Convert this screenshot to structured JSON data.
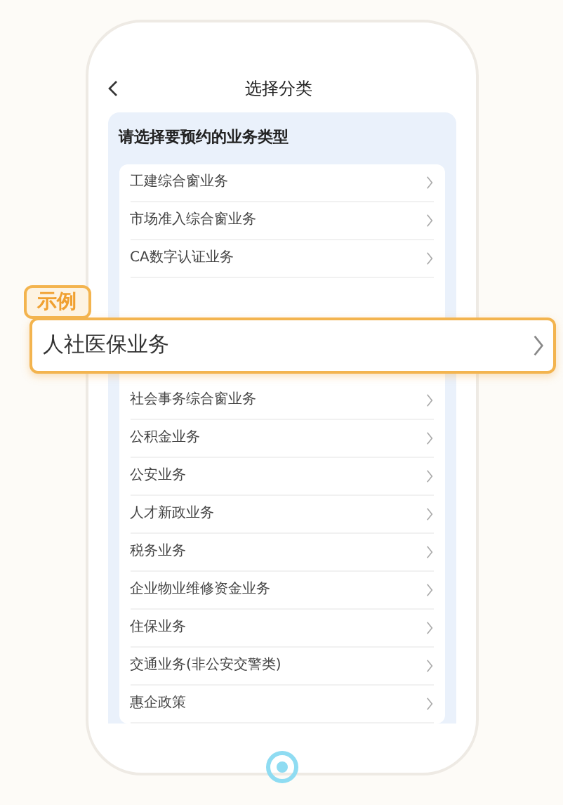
{
  "header": {
    "title": "选择分类"
  },
  "prompt": "请选择要预约的业务类型",
  "items": [
    {
      "kind": "row",
      "label": "工建综合窗业务"
    },
    {
      "kind": "row",
      "label": "市场准入综合窗业务"
    },
    {
      "kind": "row",
      "label": "CA数字认证业务"
    },
    {
      "kind": "highlight",
      "tag": "示例",
      "label": "人社医保业务"
    },
    {
      "kind": "row",
      "label": "社会事务综合窗业务"
    },
    {
      "kind": "row",
      "label": "公积金业务"
    },
    {
      "kind": "row",
      "label": "公安业务"
    },
    {
      "kind": "row",
      "label": "人才新政业务"
    },
    {
      "kind": "row",
      "label": "税务业务"
    },
    {
      "kind": "row",
      "label": "企业物业维修资金业务"
    },
    {
      "kind": "row",
      "label": "住保业务"
    },
    {
      "kind": "row",
      "label": "交通业务(非公安交警类)"
    },
    {
      "kind": "row",
      "label": "惠企政策"
    }
  ]
}
